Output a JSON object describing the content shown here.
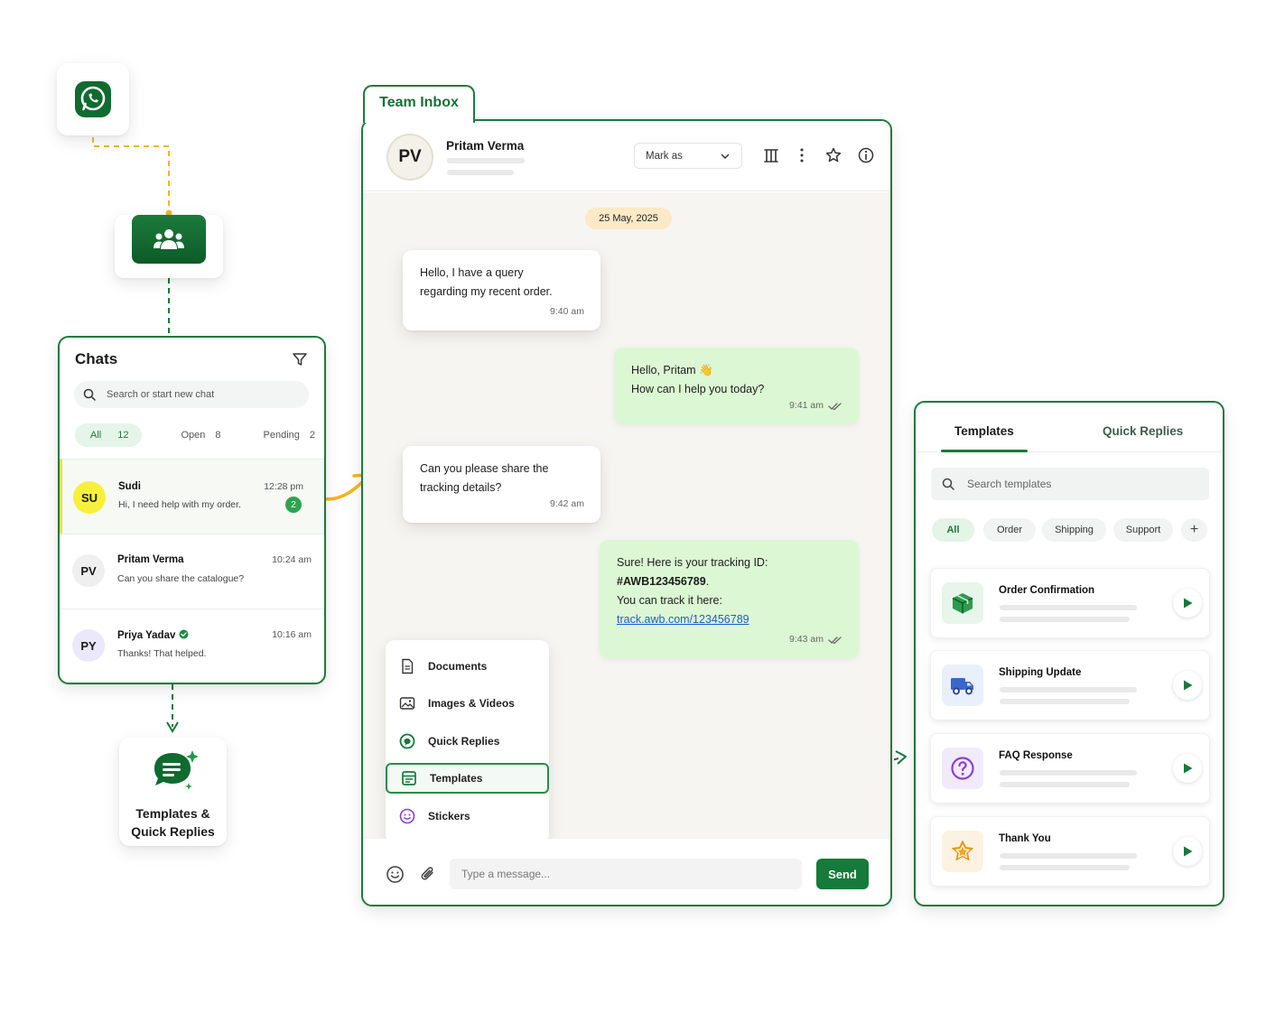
{
  "colors": {
    "brand_green": "#157a3a",
    "border_green": "#1f7a3d",
    "connector_orange": "#f5b424",
    "incoming_bubble": "#ffffff",
    "outgoing_bubble": "#dcf7d3",
    "date_pill": "#fbe9c7",
    "link_blue": "#1c5fc4"
  },
  "flow": {
    "source_icon": "whatsapp-icon",
    "team_icon": "team-group-icon",
    "end_icon": "chat-templates-icon",
    "end_label_line1": "Templates &",
    "end_label_line2": "Quick Replies"
  },
  "chats": {
    "title": "Chats",
    "search_placeholder": "Search or start new chat",
    "tabs": {
      "all_label": "All",
      "all_count": "12",
      "open_label": "Open",
      "open_count": "8",
      "pending_label": "Pending",
      "pending_count": "2"
    },
    "items": [
      {
        "initials": "SU",
        "name": "Sudi",
        "message": "Hi, I need help with my order.",
        "time": "12:28 pm",
        "unread": "2"
      },
      {
        "initials": "PV",
        "name": "Pritam Verma",
        "message": "Can you share the catalogue?",
        "time": "10:24 am"
      },
      {
        "initials": "PY",
        "name": "Priya Yadav",
        "message": "Thanks! That helped.",
        "time": "10:16 am"
      }
    ]
  },
  "inbox": {
    "tab_label": "Team Inbox",
    "contact": {
      "initials": "PV",
      "name": "Pritam Verma"
    },
    "mark_as_label": "Mark as",
    "date": "25 May, 2025",
    "messages": [
      {
        "line1": "Hello, I have a query",
        "line2": "regarding my recent order.",
        "time": "9:40 am"
      },
      {
        "line1": "Hello, Pritam 👋",
        "line2": "How can I help you today?",
        "time": "9:41 am"
      },
      {
        "line1": "Can you please share the",
        "line2": "tracking details?",
        "time": "9:42 am"
      },
      {
        "line1": "Sure! Here is your tracking ID:",
        "line2": "#AWB123456789",
        "line2_suffix": ".",
        "line3": "You can track it here:",
        "link": "track.awb.com/123456789",
        "time": "9:43 am"
      }
    ],
    "attach_menu": [
      {
        "label": "Documents",
        "icon": "document-icon"
      },
      {
        "label": "Images & Videos",
        "icon": "image-icon"
      },
      {
        "label": "Quick Replies",
        "icon": "quick-reply-icon"
      },
      {
        "label": "Templates",
        "icon": "template-icon"
      },
      {
        "label": "Stickers",
        "icon": "sticker-icon"
      }
    ],
    "composer_placeholder": "Type a message...",
    "send_label": "Send"
  },
  "templates": {
    "tab_templates": "Templates",
    "tab_quick_replies": "Quick Replies",
    "search_placeholder": "Search templates",
    "chips": [
      "All",
      "Order",
      "Shipping",
      "Support"
    ],
    "add_label": "+",
    "items": [
      {
        "title": "Order Confirmation",
        "icon": "package-icon"
      },
      {
        "title": "Shipping Update",
        "icon": "truck-icon"
      },
      {
        "title": "FAQ Response",
        "icon": "question-icon"
      },
      {
        "title": "Thank You",
        "icon": "star-icon"
      }
    ]
  }
}
